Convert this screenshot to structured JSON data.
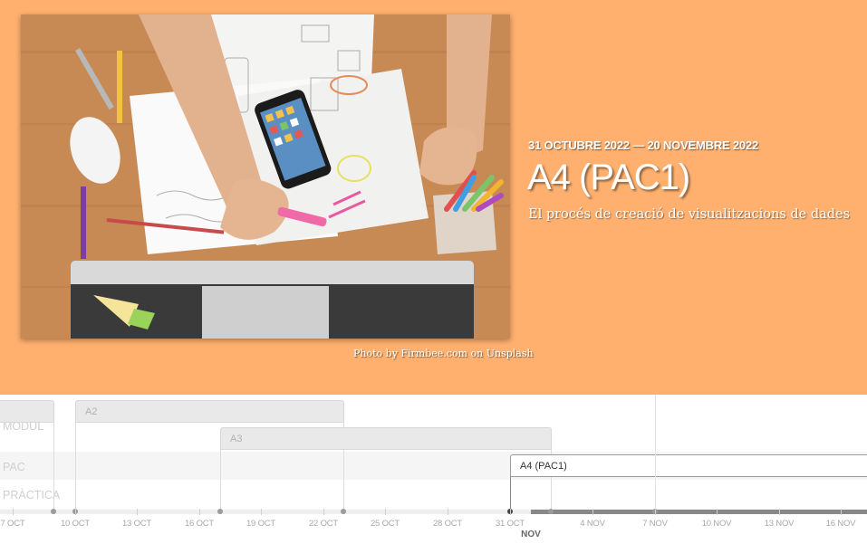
{
  "slide": {
    "background_color": "#ffb06e",
    "photo_alt": "Desk with sketches, phone and monitor",
    "credit": "Photo by Firmbee.com on Unsplash",
    "dates": "31 OCTUBRE 2022 — 20 NOVEMBRE 2022",
    "title": "A4 (PAC1)",
    "description": "El procés de creació de visualitzacions de dades"
  },
  "timeline": {
    "groups": [
      "MODUL",
      "PAC",
      "PRÀCTICA"
    ],
    "events": [
      {
        "label": "A2",
        "active": false
      },
      {
        "label": "A3",
        "active": false
      },
      {
        "label": "A4 (PAC1)",
        "active": true
      }
    ],
    "axis": {
      "ticks": [
        "7 OCT",
        "10 OCT",
        "13 OCT",
        "16 OCT",
        "19 OCT",
        "22 OCT",
        "25 OCT",
        "28 OCT",
        "31 OCT",
        "4 NOV",
        "7 NOV",
        "10 NOV",
        "13 NOV",
        "16 NOV"
      ],
      "month": "NOV"
    }
  }
}
